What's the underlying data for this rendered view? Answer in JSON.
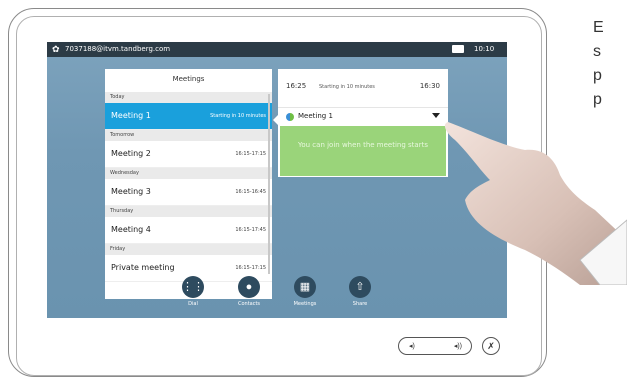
{
  "status_bar": {
    "address": "7037188@itvm.tandberg.com",
    "time": "10:10",
    "camera_icon": "camera-icon",
    "settings_icon": "gear-icon"
  },
  "meetings_panel": {
    "title": "Meetings",
    "groups": [
      {
        "day": "Today",
        "items": [
          {
            "name": "Meeting 1",
            "time": "Starting in 10 minutes",
            "selected": true
          }
        ]
      },
      {
        "day": "Tomorrow",
        "items": [
          {
            "name": "Meeting 2",
            "time": "16:15-17:15"
          }
        ]
      },
      {
        "day": "Wednesday",
        "items": [
          {
            "name": "Meeting 3",
            "time": "16:15-16:45"
          }
        ]
      },
      {
        "day": "Thursday",
        "items": [
          {
            "name": "Meeting 4",
            "time": "16:15-17:45"
          }
        ]
      },
      {
        "day": "Friday",
        "items": [
          {
            "name": "Private meeting",
            "time": "16:15-17:15"
          }
        ]
      }
    ]
  },
  "detail_panel": {
    "start": "16:25",
    "note": "Starting in 10 minutes",
    "end": "16:30",
    "selected_meeting": "Meeting 1",
    "join_message": "You can join when the meeting starts"
  },
  "dock": [
    {
      "label": "Dial",
      "icon": "dialpad-icon"
    },
    {
      "label": "Contacts",
      "icon": "person-icon"
    },
    {
      "label": "Meetings",
      "icon": "calendar-icon"
    },
    {
      "label": "Share",
      "icon": "share-icon"
    }
  ],
  "side_text": [
    "E",
    "s",
    "p",
    "p"
  ],
  "colors": {
    "accent": "#1aa0dc",
    "join_green": "#9ad47a",
    "screen_bg": "#6f97b3"
  }
}
